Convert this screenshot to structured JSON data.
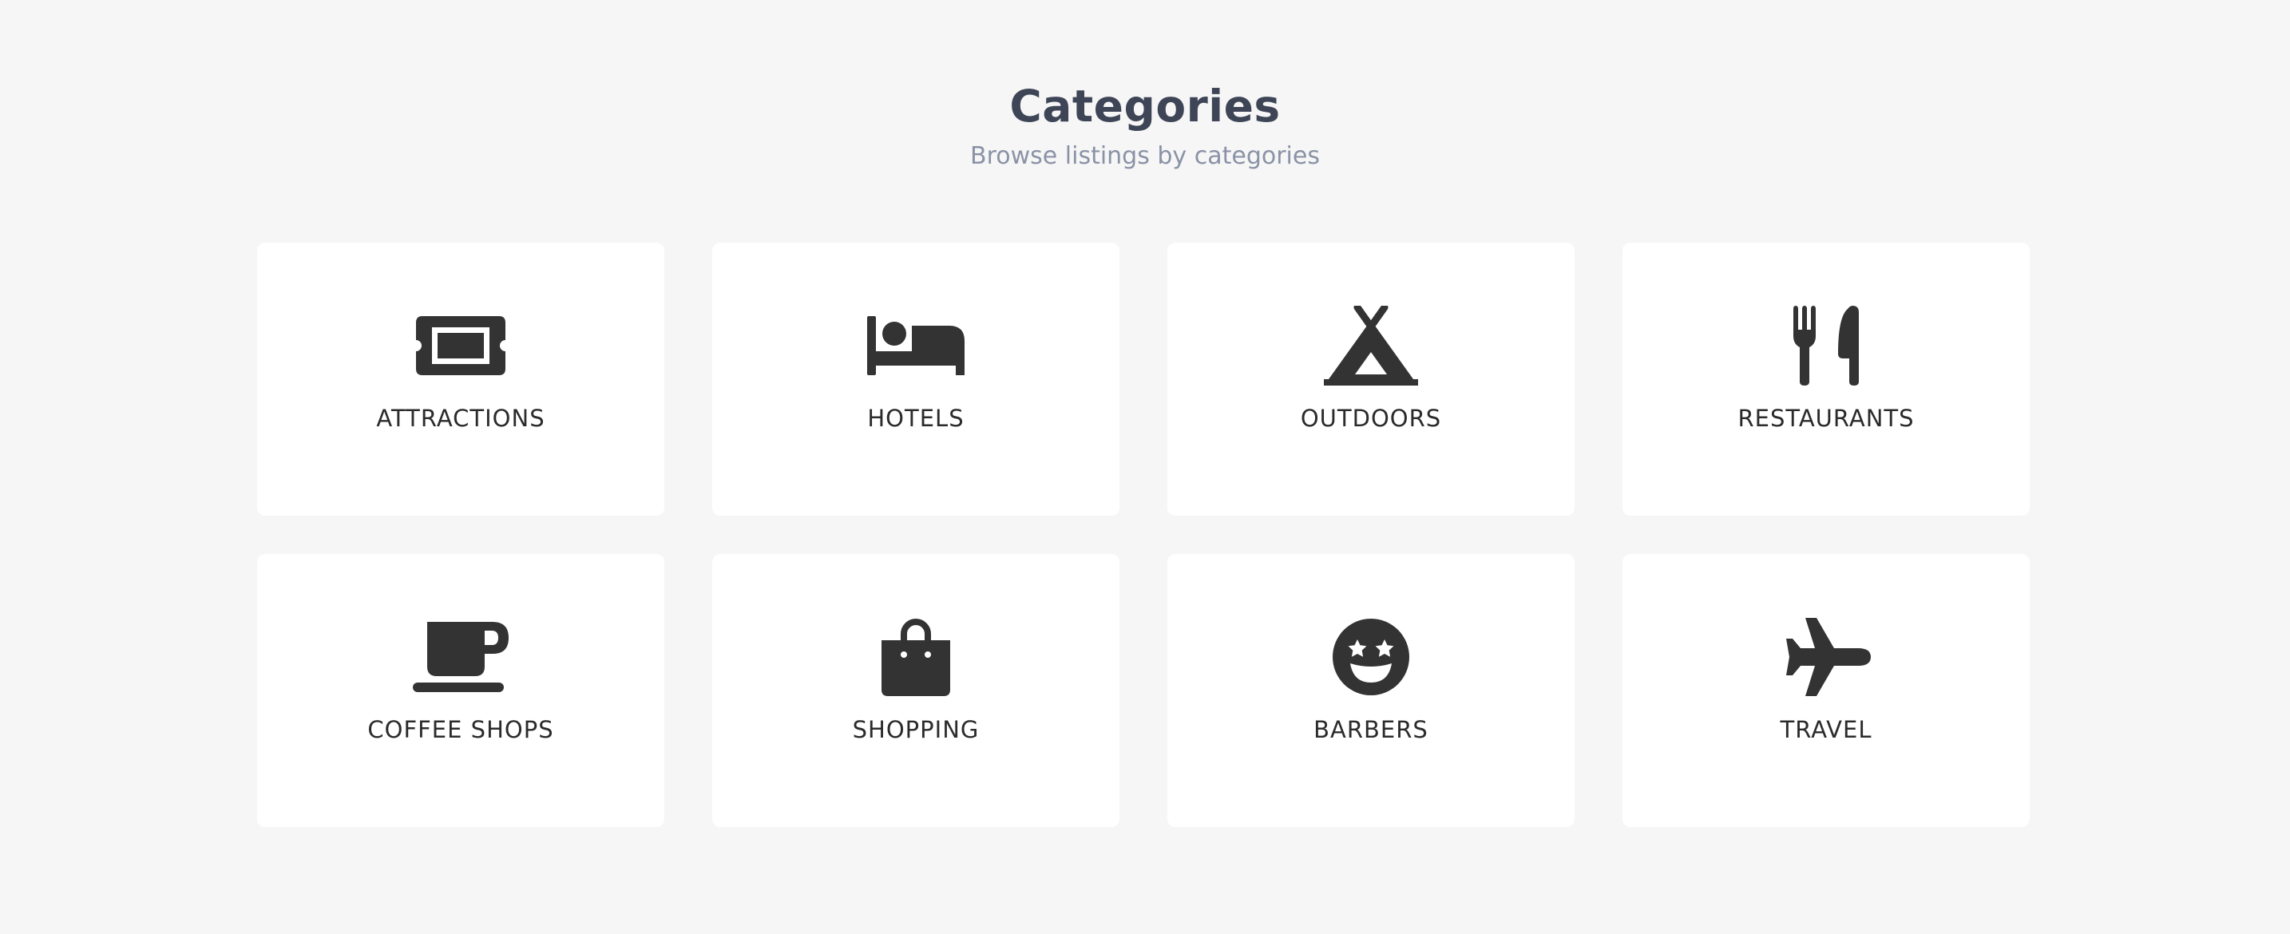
{
  "header": {
    "title": "Categories",
    "subtitle": "Browse listings by categories"
  },
  "colors": {
    "background": "#f6f6f6",
    "card": "#ffffff",
    "icon": "#333333",
    "title": "#3d4556",
    "subtitle": "#8a92a6"
  },
  "categories": [
    {
      "label": "ATTRACTIONS",
      "icon": "ticket-icon"
    },
    {
      "label": "HOTELS",
      "icon": "bed-icon"
    },
    {
      "label": "OUTDOORS",
      "icon": "tent-icon"
    },
    {
      "label": "RESTAURANTS",
      "icon": "utensils-icon"
    },
    {
      "label": "COFFEE SHOPS",
      "icon": "coffee-cup-icon"
    },
    {
      "label": "SHOPPING",
      "icon": "shopping-bag-icon"
    },
    {
      "label": "BARBERS",
      "icon": "star-eyes-face-icon"
    },
    {
      "label": "TRAVEL",
      "icon": "airplane-icon"
    }
  ]
}
